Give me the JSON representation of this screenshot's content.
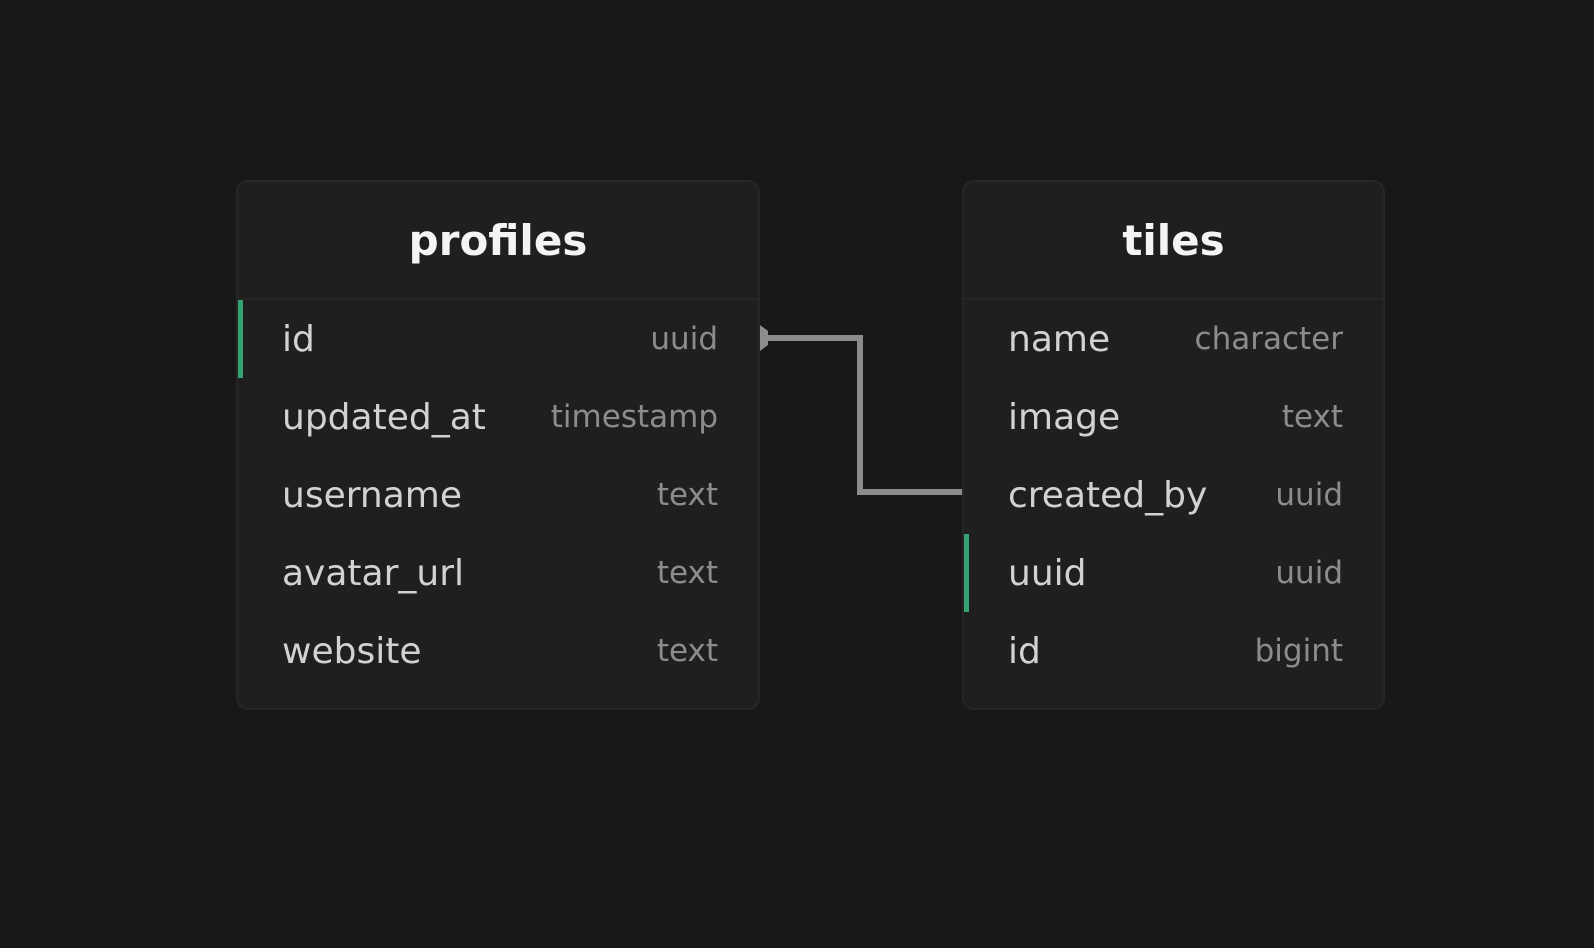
{
  "colors": {
    "background": "#181818",
    "table_background": "#1f1f1f",
    "key_marker": "#3ecf8e",
    "relation_line": "#8c8c8c"
  },
  "tables": [
    {
      "name": "profiles",
      "columns": [
        {
          "name": "id",
          "type": "uuid",
          "key": true
        },
        {
          "name": "updated_at",
          "type": "timestamp",
          "key": false
        },
        {
          "name": "username",
          "type": "text",
          "key": false
        },
        {
          "name": "avatar_url",
          "type": "text",
          "key": false
        },
        {
          "name": "website",
          "type": "text",
          "key": false
        }
      ]
    },
    {
      "name": "tiles",
      "columns": [
        {
          "name": "name",
          "type": "character",
          "key": false
        },
        {
          "name": "image",
          "type": "text",
          "key": false
        },
        {
          "name": "created_by",
          "type": "uuid",
          "key": false
        },
        {
          "name": "uuid",
          "type": "uuid",
          "key": true
        },
        {
          "name": "id",
          "type": "bigint",
          "key": false
        }
      ]
    }
  ],
  "relation": {
    "from": "profiles.id",
    "to": "tiles.created_by"
  }
}
